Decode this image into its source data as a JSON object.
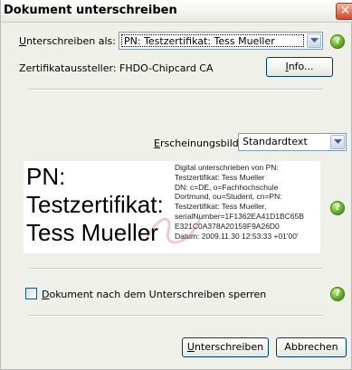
{
  "window": {
    "title": "Dokument unterschreiben",
    "close_glyph": "✕"
  },
  "sign_as": {
    "label_underlined": "U",
    "label_rest": "nterschreiben als:",
    "selected": "PN: Testzertifikat: Tess Mueller"
  },
  "issuer": {
    "text": "Zertifikataussteller: FHDO-Chipcard CA"
  },
  "info_button": {
    "label_underlined": "I",
    "label_rest": "nfo..."
  },
  "appearance": {
    "label_underlined": "E",
    "label_rest": "rscheinungsbild:",
    "selected": "Standardtext"
  },
  "preview": {
    "name_lines": [
      "PN:",
      "Testzertifikat:",
      "Tess Mueller"
    ],
    "detail_lines": [
      "Digital unterschrieben von PN:",
      "Testzertifikat: Tess Mueller",
      "DN: c=DE, o=Fachhochschule",
      "Dortmund, ou=Student, cn=PN:",
      "Testzertifikat: Tess Mueller,",
      "serialNumber=1F1362EA41D1BC65B",
      "E321C0A378A20159F9A26D0",
      "Datum: 2009.11.30 12:53:33 +01'00'"
    ]
  },
  "lock_option": {
    "label_underlined": "D",
    "label_rest": "okument nach dem Unterschreiben sperren",
    "checked": false
  },
  "sign_button": {
    "label_underlined": "U",
    "label_rest": "nterschreiben"
  },
  "cancel_button": {
    "label": "Abbrechen"
  },
  "help_glyph": "?",
  "colors": {
    "dialog_bg": "#f0f0ea",
    "help_icon_green": "#4f9e16",
    "close_red": "#d8452a",
    "button_border": "#003c74"
  },
  "icons": [
    "close-icon",
    "chevron-down-icon",
    "help-icon"
  ]
}
